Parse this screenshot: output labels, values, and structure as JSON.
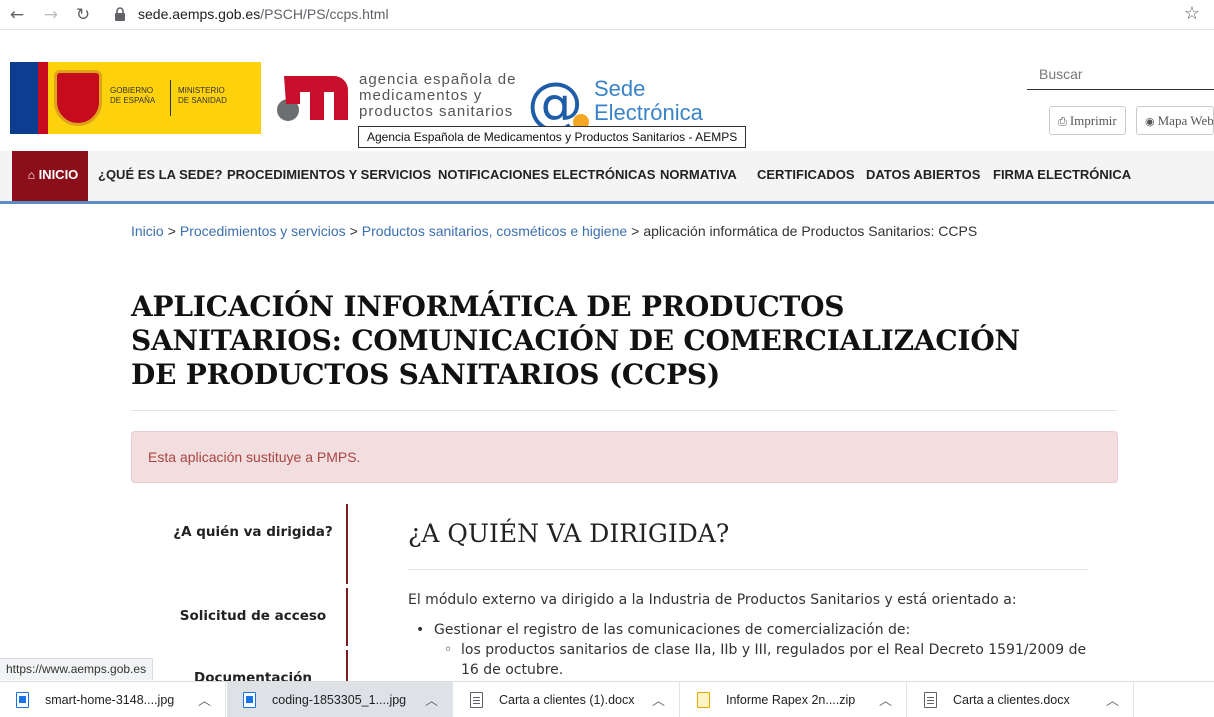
{
  "browser": {
    "url_host": "sede.aemps.gob.es",
    "url_path": "/PSCH/PS/ccps.html"
  },
  "header": {
    "gov_text_1": "GOBIERNO\nDE ESPAÑA",
    "gov_text_2": "MINISTERIO\nDE SANIDAD",
    "agency_text": "agencia española de\nmedicamentos y\nproductos sanitarios",
    "sede_text": "Sede\nElectrónica",
    "tooltip": "Agencia Española de Medicamentos y Productos Sanitarios - AEMPS",
    "search_placeholder": "Buscar",
    "print_label": "Imprimir",
    "sitemap_label": "Mapa Web"
  },
  "nav": {
    "home": "INICIO",
    "items": [
      "¿QUÉ ES LA SEDE?",
      "PROCEDIMIENTOS Y SERVICIOS",
      "NOTIFICACIONES ELECTRÓNICAS",
      "NORMATIVA",
      "CERTIFICADOS",
      "DATOS ABIERTOS",
      "FIRMA ELECTRÓNICA"
    ]
  },
  "breadcrumb": {
    "items": [
      "Inicio",
      "Procedimientos y servicios",
      "Productos sanitarios, cosméticos e higiene"
    ],
    "current": "aplicación informática de Productos Sanitarios: CCPS",
    "separator": ">"
  },
  "page": {
    "title": "APLICACIÓN INFORMÁTICA DE PRODUCTOS SANITARIOS: COMUNICACIÓN DE COMERCIALIZACIÓN DE PRODUCTOS SANITARIOS (CCPS)",
    "alert": "Esta aplicación sustituye a PMPS.",
    "side_tabs": [
      "¿A quién va dirigida?",
      "Solicitud de acceso",
      "Documentación"
    ],
    "section_heading": "¿A QUIÉN VA DIRIGIDA?",
    "intro": "El módulo externo va dirigido a la Industria de Productos Sanitarios y está orientado a:",
    "bullet_1": "Gestionar el registro de las comunicaciones de comercialización de:",
    "sub_bullet_1": "los productos sanitarios de clase IIa, IIb y III, regulados por el Real Decreto 1591/2009 de 16 de octubre."
  },
  "status_url": "https://www.aemps.gob.es",
  "downloads": [
    {
      "name": "smart-home-3148....jpg",
      "type": "image"
    },
    {
      "name": "coding-1853305_1....jpg",
      "type": "image"
    },
    {
      "name": "Carta a clientes (1).docx",
      "type": "doc"
    },
    {
      "name": "Informe Rapex 2n....zip",
      "type": "zip"
    },
    {
      "name": "Carta a clientes.docx",
      "type": "doc"
    }
  ],
  "colors": {
    "nav_home_bg": "#8b0e1a",
    "link": "#3b6fb1",
    "alert_bg": "#f2dede",
    "alert_text": "#a94442",
    "nav_underline": "#5a8dc6"
  }
}
